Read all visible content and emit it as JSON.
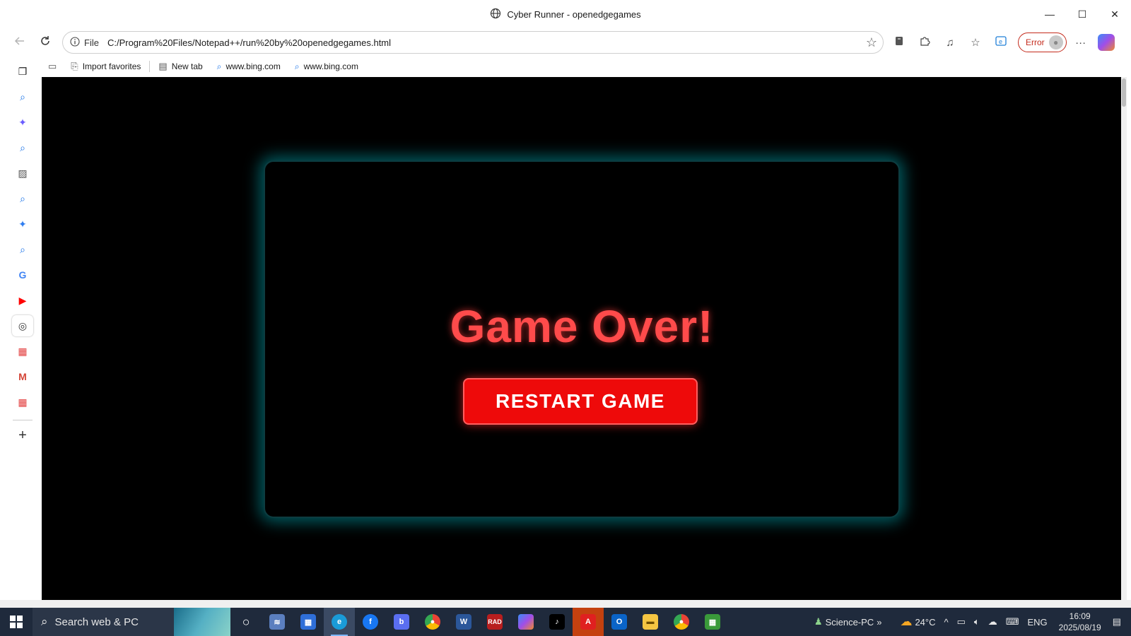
{
  "window": {
    "title": "Cyber Runner - openedgegames",
    "minimize": "—",
    "maximize": "☐",
    "close": "✕"
  },
  "nav": {
    "file_tag": "File",
    "url": "C:/Program%20Files/Notepad++/run%20by%20openedgegames.html",
    "error_label": "Error"
  },
  "favorites": [
    {
      "label": "Import favorites"
    },
    {
      "label": "New tab"
    },
    {
      "label": "www.bing.com"
    },
    {
      "label": "www.bing.com"
    }
  ],
  "sidebar_icons": [
    "tabs-icon",
    "search-icon",
    "copilot-icon",
    "search-icon",
    "image-icon",
    "search-icon",
    "copilot-icon",
    "search-icon",
    "google-icon",
    "youtube-icon",
    "globe-icon",
    "store-icon",
    "gmail-icon",
    "store-icon",
    "add-icon"
  ],
  "game": {
    "message": "Game Over!",
    "restart_label": "RESTART GAME",
    "colors": {
      "message": "#ff4b4b",
      "button": "#ee0a0a",
      "panel_glow": "#00c8d2"
    }
  },
  "taskbar": {
    "search_placeholder": "Search web & PC",
    "network_label": "Science-PC",
    "temperature": "24°C",
    "language": "ENG",
    "time": "16:09",
    "date": "2025/08/19"
  }
}
